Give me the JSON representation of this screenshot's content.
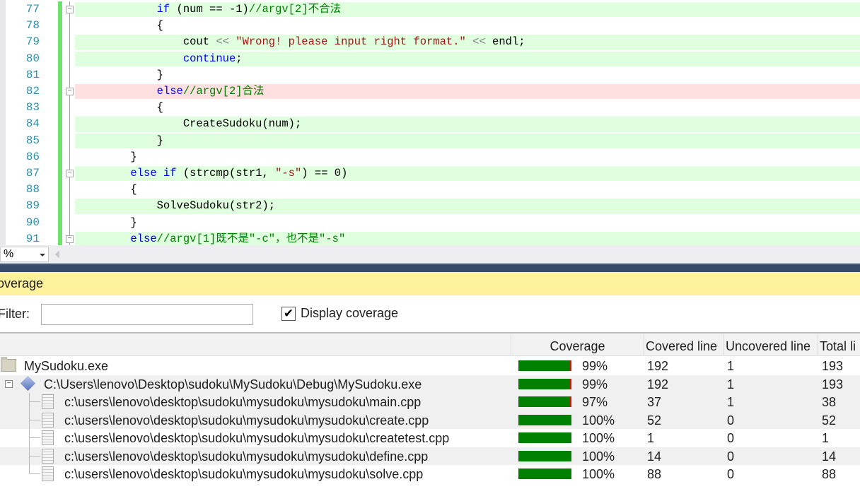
{
  "editor": {
    "lines": [
      {
        "num": "77",
        "hl": "green",
        "fold": "box",
        "indent": "            ",
        "tokens": [
          [
            "kw",
            "if"
          ],
          [
            "tx",
            " (num == -1)"
          ],
          [
            "cm",
            "//argv[2]不合法"
          ]
        ]
      },
      {
        "num": "78",
        "hl": "",
        "fold": "line",
        "indent": "            ",
        "tokens": [
          [
            "tx",
            "{"
          ]
        ]
      },
      {
        "num": "79",
        "hl": "green",
        "fold": "line",
        "indent": "                ",
        "tokens": [
          [
            "tx",
            "cout "
          ],
          [
            "op",
            "<<"
          ],
          [
            "tx",
            " "
          ],
          [
            "str",
            "\"Wrong! please input right format.\""
          ],
          [
            "tx",
            " "
          ],
          [
            "op",
            "<<"
          ],
          [
            "tx",
            " endl;"
          ]
        ]
      },
      {
        "num": "80",
        "hl": "green",
        "fold": "line",
        "indent": "                ",
        "tokens": [
          [
            "kw",
            "continue"
          ],
          [
            "tx",
            ";"
          ]
        ]
      },
      {
        "num": "81",
        "hl": "",
        "fold": "line",
        "indent": "            ",
        "tokens": [
          [
            "tx",
            "}"
          ]
        ]
      },
      {
        "num": "82",
        "hl": "red",
        "fold": "box",
        "indent": "            ",
        "tokens": [
          [
            "kw",
            "else"
          ],
          [
            "cm",
            "//argv[2]合法"
          ]
        ]
      },
      {
        "num": "83",
        "hl": "",
        "fold": "line",
        "indent": "            ",
        "tokens": [
          [
            "tx",
            "{"
          ]
        ]
      },
      {
        "num": "84",
        "hl": "green",
        "fold": "line",
        "indent": "                ",
        "tokens": [
          [
            "tx",
            "CreateSudoku(num);"
          ]
        ]
      },
      {
        "num": "85",
        "hl": "green",
        "fold": "line",
        "indent": "            ",
        "tokens": [
          [
            "tx",
            "}"
          ]
        ]
      },
      {
        "num": "86",
        "hl": "",
        "fold": "line",
        "indent": "        ",
        "tokens": [
          [
            "tx",
            "}"
          ]
        ]
      },
      {
        "num": "87",
        "hl": "green",
        "fold": "box",
        "indent": "        ",
        "tokens": [
          [
            "kw",
            "else if"
          ],
          [
            "tx",
            " (strcmp(str1, "
          ],
          [
            "str",
            "\"-s\""
          ],
          [
            "tx",
            ") == 0)"
          ]
        ]
      },
      {
        "num": "88",
        "hl": "",
        "fold": "line",
        "indent": "        ",
        "tokens": [
          [
            "tx",
            "{"
          ]
        ]
      },
      {
        "num": "89",
        "hl": "green",
        "fold": "line",
        "indent": "            ",
        "tokens": [
          [
            "tx",
            "SolveSudoku(str2);"
          ]
        ]
      },
      {
        "num": "90",
        "hl": "",
        "fold": "line",
        "indent": "        ",
        "tokens": [
          [
            "tx",
            "}"
          ]
        ]
      },
      {
        "num": "91",
        "hl": "green",
        "fold": "box",
        "indent": "        ",
        "tokens": [
          [
            "kw",
            "else"
          ],
          [
            "cm",
            "//argv[1]既不是\"-c\"，也不是\"-s\""
          ]
        ]
      }
    ]
  },
  "status": {
    "zoom": "%"
  },
  "panel": {
    "title": "overage",
    "filter_label": "Filter:",
    "filter_value": "",
    "display_coverage_label": "Display coverage",
    "display_coverage_checked": true,
    "columns": [
      "Coverage",
      "Covered line",
      "Uncovered line",
      "Total li"
    ],
    "rows": [
      {
        "name": "MySudoku.exe",
        "icon": "folder",
        "pct": "99%",
        "fraction": 0.99,
        "covered": "192",
        "uncovered": "1",
        "total": "193"
      },
      {
        "name": "C:\\Users\\lenovo\\Desktop\\sudoku\\MySudoku\\Debug\\MySudoku.exe",
        "icon": "module",
        "pct": "99%",
        "fraction": 0.99,
        "covered": "192",
        "uncovered": "1",
        "total": "193"
      },
      {
        "name": "c:\\users\\lenovo\\desktop\\sudoku\\mysudoku\\mysudoku\\main.cpp",
        "icon": "file",
        "pct": "97%",
        "fraction": 0.97,
        "covered": "37",
        "uncovered": "1",
        "total": "38"
      },
      {
        "name": "c:\\users\\lenovo\\desktop\\sudoku\\mysudoku\\mysudoku\\create.cpp",
        "icon": "file",
        "pct": "100%",
        "fraction": 1,
        "covered": "52",
        "uncovered": "0",
        "total": "52"
      },
      {
        "name": "c:\\users\\lenovo\\desktop\\sudoku\\mysudoku\\mysudoku\\createtest.cpp",
        "icon": "file",
        "pct": "100%",
        "fraction": 1,
        "covered": "1",
        "uncovered": "0",
        "total": "1"
      },
      {
        "name": "c:\\users\\lenovo\\desktop\\sudoku\\mysudoku\\mysudoku\\define.cpp",
        "icon": "file",
        "pct": "100%",
        "fraction": 1,
        "covered": "14",
        "uncovered": "0",
        "total": "14"
      },
      {
        "name": "c:\\users\\lenovo\\desktop\\sudoku\\mysudoku\\mysudoku\\solve.cpp",
        "icon": "file",
        "pct": "100%",
        "fraction": 1,
        "covered": "88",
        "uncovered": "0",
        "total": "88"
      }
    ]
  },
  "colors": {
    "covered": "#008000",
    "uncovered": "#ff0000",
    "title_bar": "#fff29d",
    "covered_line": "#dfffdf",
    "uncovered_line": "#ffdfdf"
  }
}
